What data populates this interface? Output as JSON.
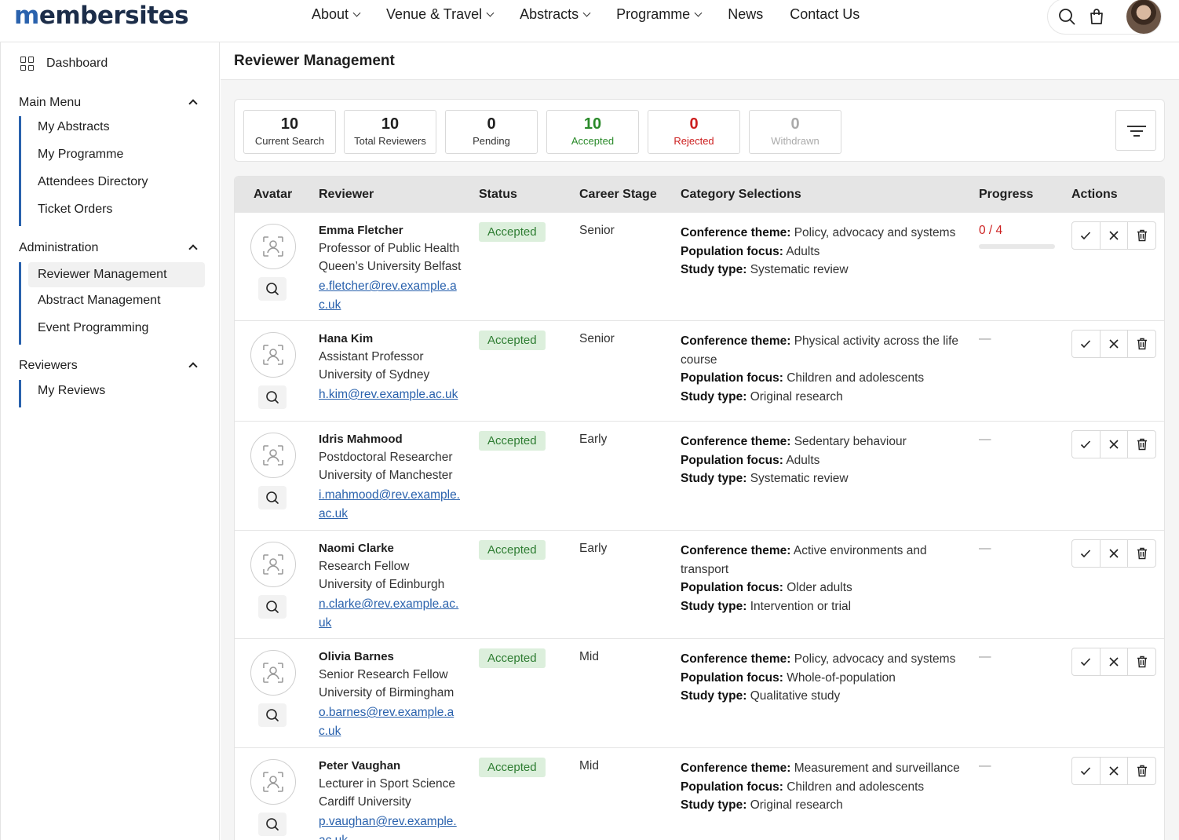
{
  "brand": {
    "logo_first": "m",
    "logo_rest": "embersites"
  },
  "nav": {
    "items": [
      {
        "label": "About",
        "dropdown": true
      },
      {
        "label": "Venue & Travel",
        "dropdown": true
      },
      {
        "label": "Abstracts",
        "dropdown": true
      },
      {
        "label": "Programme",
        "dropdown": true
      },
      {
        "label": "News",
        "dropdown": false
      },
      {
        "label": "Contact Us",
        "dropdown": false
      }
    ],
    "icons": [
      "search-icon",
      "cart-icon",
      "user-avatar"
    ]
  },
  "sidebar": {
    "dashboard": "Dashboard",
    "sections": [
      {
        "title": "Main Menu",
        "items": [
          "My Abstracts",
          "My Programme",
          "Attendees Directory",
          "Ticket Orders"
        ]
      },
      {
        "title": "Administration",
        "items": [
          "Reviewer Management",
          "Abstract Management",
          "Event Programming"
        ],
        "active": "Reviewer Management"
      },
      {
        "title": "Reviewers",
        "items": [
          "My Reviews"
        ]
      }
    ]
  },
  "page": {
    "title": "Reviewer Management"
  },
  "stats": [
    {
      "value": "10",
      "label": "Current Search",
      "tone": "default"
    },
    {
      "value": "10",
      "label": "Total Reviewers",
      "tone": "default"
    },
    {
      "value": "0",
      "label": "Pending",
      "tone": "default"
    },
    {
      "value": "10",
      "label": "Accepted",
      "tone": "green"
    },
    {
      "value": "0",
      "label": "Rejected",
      "tone": "red"
    },
    {
      "value": "0",
      "label": "Withdrawn",
      "tone": "grey"
    }
  ],
  "table": {
    "columns": [
      "Avatar",
      "Reviewer",
      "Status",
      "Career Stage",
      "Category Selections",
      "Progress",
      "Actions"
    ],
    "category_labels": {
      "theme": "Conference theme:",
      "population": "Population focus:",
      "study": "Study type:"
    },
    "rows": [
      {
        "name": "Emma Fletcher",
        "title": "Professor of Public Health",
        "institution": "Queen’s University Belfast",
        "email": "e.fletcher@rev.example.ac.uk",
        "status": "Accepted",
        "career": "Senior",
        "theme": "Policy, advocacy and systems",
        "population": "Adults",
        "study": "Systematic review",
        "progress": "0 / 4",
        "progress_fraction": 0
      },
      {
        "name": "Hana Kim",
        "title": "Assistant Professor",
        "institution": "University of Sydney",
        "email": "h.kim@rev.example.ac.uk",
        "status": "Accepted",
        "career": "Senior",
        "theme": "Physical activity across the life course",
        "population": "Children and adolescents",
        "study": "Original research",
        "progress": "—"
      },
      {
        "name": "Idris Mahmood",
        "title": "Postdoctoral Researcher",
        "institution": "University of Manchester",
        "email": "i.mahmood@rev.example.ac.uk",
        "status": "Accepted",
        "career": "Early",
        "theme": "Sedentary behaviour",
        "population": "Adults",
        "study": "Systematic review",
        "progress": "—"
      },
      {
        "name": "Naomi Clarke",
        "title": "Research Fellow",
        "institution": "University of Edinburgh",
        "email": "n.clarke@rev.example.ac.uk",
        "status": "Accepted",
        "career": "Early",
        "theme": "Active environments and transport",
        "population": "Older adults",
        "study": "Intervention or trial",
        "progress": "—"
      },
      {
        "name": "Olivia Barnes",
        "title": "Senior Research Fellow",
        "institution": "University of Birmingham",
        "email": "o.barnes@rev.example.ac.uk",
        "status": "Accepted",
        "career": "Mid",
        "theme": "Policy, advocacy and systems",
        "population": "Whole-of-population",
        "study": "Qualitative study",
        "progress": "—"
      },
      {
        "name": "Peter Vaughan",
        "title": "Lecturer in Sport Science",
        "institution": "Cardiff University",
        "email": "p.vaughan@rev.example.ac.uk",
        "status": "Accepted",
        "career": "Mid",
        "theme": "Measurement and surveillance",
        "population": "Children and adolescents",
        "study": "Original research",
        "progress": "—"
      }
    ]
  }
}
